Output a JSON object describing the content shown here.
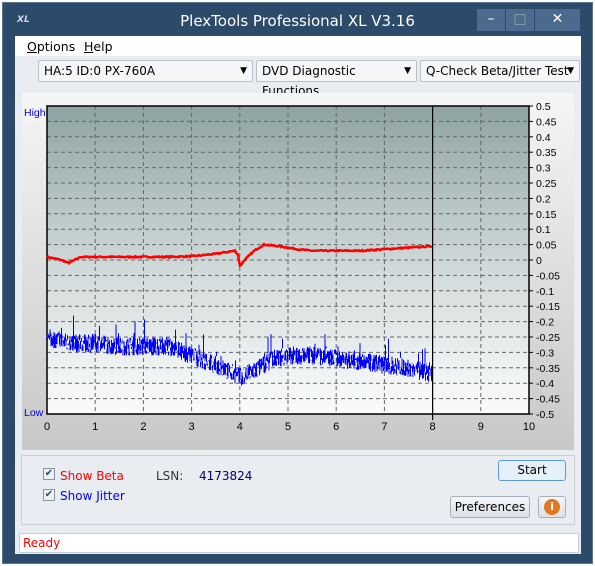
{
  "window": {
    "title": "PlexTools Professional XL V3.16",
    "logo": "XL",
    "controls": [
      "minimize",
      "maximize",
      "close"
    ]
  },
  "menu": {
    "items": [
      {
        "label": "Options",
        "accel": "O"
      },
      {
        "label": "Help",
        "accel": "H"
      }
    ]
  },
  "toolbar": {
    "drive": "HA:5 ID:0  PX-760A",
    "function": "DVD Diagnostic Functions",
    "test": "Q-Check Beta/Jitter Test"
  },
  "chart_data": {
    "type": "line",
    "left_labels": {
      "high": "High",
      "low": "Low"
    },
    "xlim": [
      0,
      10
    ],
    "ylim": [
      -0.5,
      0.5
    ],
    "x_ticks": [
      "0",
      "1",
      "2",
      "3",
      "4",
      "5",
      "6",
      "7",
      "8",
      "9",
      "10"
    ],
    "y_ticks": [
      "0.5",
      "0.45",
      "0.4",
      "0.35",
      "0.3",
      "0.25",
      "0.2",
      "0.15",
      "0.1",
      "0.05",
      "0",
      "-0.05",
      "-0.1",
      "-0.15",
      "-0.2",
      "-0.25",
      "-0.3",
      "-0.35",
      "-0.4",
      "-0.45",
      "-0.5"
    ],
    "grid": true,
    "cursor_x": 8,
    "series": [
      {
        "key": "beta",
        "color": "#ff0000",
        "x": [
          0,
          0.3,
          0.45,
          0.7,
          1.0,
          1.5,
          2.0,
          2.5,
          3.0,
          3.5,
          3.9,
          3.97,
          4.0,
          4.1,
          4.3,
          4.5,
          4.8,
          5.2,
          5.5,
          6.0,
          6.5,
          7.0,
          7.5,
          8.0
        ],
        "y": [
          0.01,
          0.0,
          -0.01,
          0.01,
          0.01,
          0.01,
          0.01,
          0.01,
          0.012,
          0.02,
          0.03,
          0.015,
          -0.02,
          0.0,
          0.03,
          0.05,
          0.045,
          0.035,
          0.03,
          0.03,
          0.03,
          0.035,
          0.04,
          0.045
        ]
      },
      {
        "key": "jitter",
        "color": "#0000ff",
        "x": [
          0,
          0.5,
          1.0,
          1.5,
          2.0,
          2.5,
          3.0,
          3.5,
          4.0,
          4.3,
          4.7,
          5.0,
          5.5,
          6.0,
          6.5,
          7.0,
          7.5,
          8.0
        ],
        "y": [
          -0.25,
          -0.27,
          -0.27,
          -0.28,
          -0.28,
          -0.28,
          -0.31,
          -0.34,
          -0.38,
          -0.36,
          -0.32,
          -0.31,
          -0.31,
          -0.32,
          -0.33,
          -0.34,
          -0.35,
          -0.37
        ]
      }
    ]
  },
  "controls": {
    "show_beta": {
      "label": "Show Beta",
      "checked": true,
      "color": "#ff0000"
    },
    "show_jitter": {
      "label": "Show Jitter",
      "checked": true,
      "color": "#0000ff"
    },
    "lsn_label": "LSN:",
    "lsn_value": "4173824",
    "start": "Start",
    "preferences": "Preferences",
    "info": "i"
  },
  "status": "Ready"
}
